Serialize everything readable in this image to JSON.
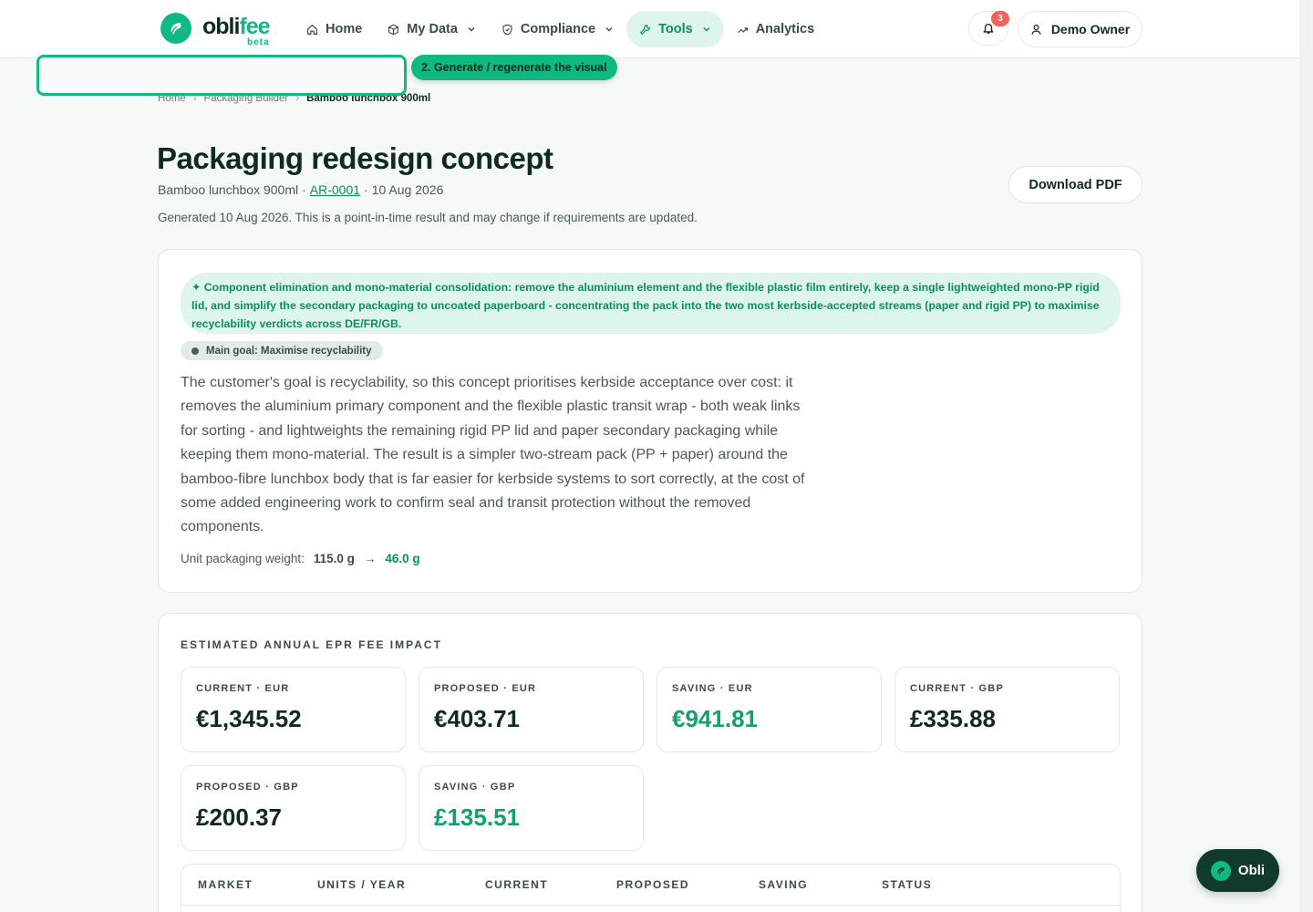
{
  "brand": {
    "name_main": "obli",
    "name_accent": "fee",
    "tag": "beta",
    "accent_color": "#10b981",
    "dark_color": "#0f2a22"
  },
  "nav": {
    "items": [
      {
        "label": "Home",
        "icon": "home-icon"
      },
      {
        "label": "My Data",
        "icon": "box-icon",
        "has_menu": true
      },
      {
        "label": "Compliance",
        "icon": "shield-icon",
        "has_menu": true
      },
      {
        "label": "Tools",
        "icon": "wrench-icon",
        "has_menu": true,
        "active": true
      },
      {
        "label": "Analytics",
        "icon": "trend-icon"
      }
    ],
    "notifications_count": "3",
    "user_label": "Demo Owner"
  },
  "tour": {
    "tip": "2. Generate / regenerate the visual"
  },
  "breadcrumb": [
    "Home",
    "Packaging Builder",
    "Bamboo lunchbox 900ml"
  ],
  "header": {
    "title": "Packaging redesign concept",
    "product": "Bamboo lunchbox 900ml",
    "sep1": "·",
    "ref": "AR-0001",
    "sep2": "·",
    "date": "10 Aug 2026",
    "generated_note": "Generated 10 Aug 2026. This is a point-in-time result and may change if requirements are updated.",
    "download_label": "Download PDF"
  },
  "concept": {
    "banner": "✦ Component elimination and mono-material consolidation: remove the aluminium element and the flexible plastic film entirely, keep a single lightweighted mono-PP rigid lid, and simplify the secondary packaging to uncoated paperboard - concentrating the pack into the two most kerbside-accepted streams (paper and rigid PP) to maximise recyclability verdicts across DE/FR/GB.",
    "goal": "Main goal: Maximise recyclability",
    "description": "The customer's goal is recyclability, so this concept prioritises kerbside acceptance over cost: it removes the aluminium primary component and the flexible plastic transit wrap - both weak links for sorting - and lightweights the remaining rigid PP lid and paper secondary packaging while keeping them mono-material. The result is a simpler two-stream pack (PP + paper) around the bamboo-fibre lunchbox body that is far easier for kerbside systems to sort correctly, at the cost of some added engineering work to confirm seal and transit protection without the removed components.",
    "weight_label": "Unit packaging weight:",
    "weight_from": "115.0 g",
    "weight_arrow": "→",
    "weight_to": "46.0 g"
  },
  "fees": {
    "heading": "ESTIMATED ANNUAL EPR FEE IMPACT",
    "boxes": [
      {
        "label": "CURRENT · EUR",
        "value": "€1,345.52",
        "kind": "normal"
      },
      {
        "label": "PROPOSED · EUR",
        "value": "€403.71",
        "kind": "normal"
      },
      {
        "label": "SAVING · EUR",
        "value": "€941.81",
        "kind": "saving"
      },
      {
        "label": "CURRENT · GBP",
        "value": "£335.88",
        "kind": "normal"
      },
      {
        "label": "PROPOSED · GBP",
        "value": "£200.37",
        "kind": "normal"
      },
      {
        "label": "SAVING · GBP",
        "value": "£135.51",
        "kind": "saving"
      }
    ],
    "table_headers": [
      "MARKET",
      "UNITS / YEAR",
      "CURRENT",
      "PROPOSED",
      "SAVING",
      "STATUS"
    ]
  },
  "assistant": {
    "label": "Obli"
  }
}
